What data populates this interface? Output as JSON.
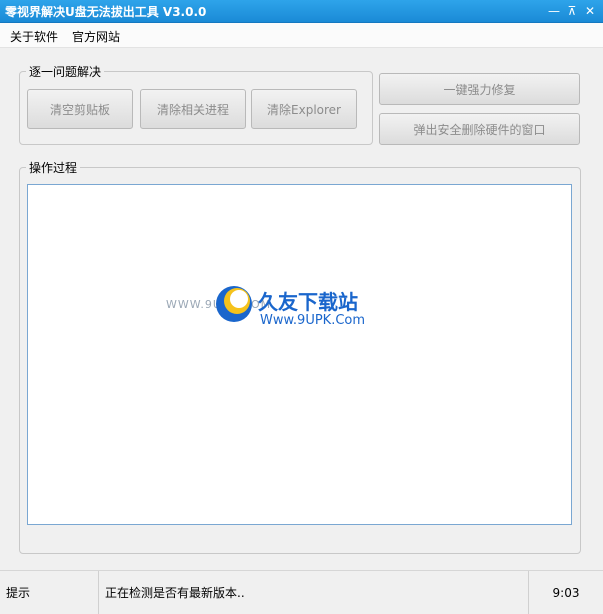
{
  "window": {
    "title": "零视界解决U盘无法拔出工具 V3.0.0"
  },
  "window_controls": {
    "minimize": "—",
    "restore": "⊼",
    "close": "✕"
  },
  "menu": {
    "items": [
      {
        "label": "关于软件"
      },
      {
        "label": "官方网站"
      }
    ]
  },
  "problem_group": {
    "legend": "逐一问题解决",
    "buttons": [
      {
        "label": "清空剪贴板"
      },
      {
        "label": "清除相关进程"
      },
      {
        "label": "清除Explorer"
      }
    ]
  },
  "right_buttons": {
    "repair": "一键强力修复",
    "eject_dialog": "弹出安全删除硬件的窗口"
  },
  "process_group": {
    "legend": "操作过程"
  },
  "watermark": {
    "left_text": "WWW.9UPK.COM",
    "title": "久友下载站",
    "url": "Www.9UPK.Com"
  },
  "status": {
    "label": "提示",
    "message": "正在检测是否有最新版本..",
    "time": "9:03"
  },
  "colors": {
    "titlebar": "#1a8ad6",
    "accent": "#1a66cc"
  }
}
